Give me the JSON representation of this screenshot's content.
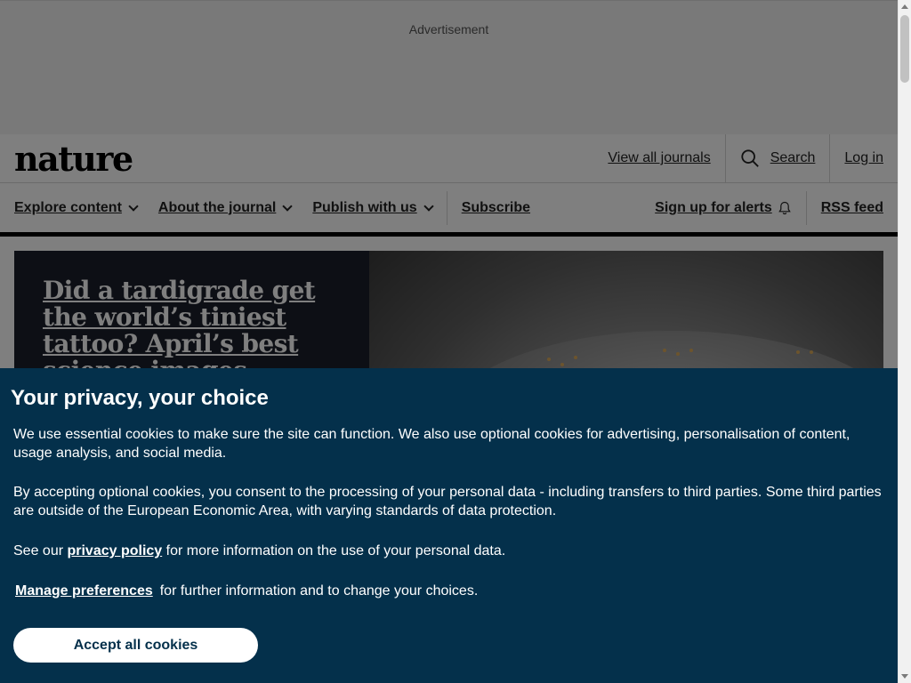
{
  "ad": {
    "label": "Advertisement"
  },
  "masthead": {
    "logo": "nature",
    "view_all_journals": "View all journals",
    "search_label": "Search",
    "login_label": "Log in"
  },
  "nav": {
    "explore": "Explore content",
    "about": "About the journal",
    "publish": "Publish with us",
    "subscribe": "Subscribe",
    "alerts": "Sign up for alerts",
    "rss": "RSS feed"
  },
  "hero": {
    "title_lines": [
      "Did a tardigrade get",
      "the world’s tiniest",
      "tattoo? April’s best",
      "science images"
    ]
  },
  "cookie": {
    "title": "Your privacy, your choice",
    "p1": "We use essential cookies to make sure the site can function. We also use optional cookies for advertising, personalisation of content, usage analysis, and social media.",
    "p2": "By accepting optional cookies, you consent to the processing of your personal data - including transfers to third parties. Some third parties are outside of the European Economic Area, with varying standards of data protection.",
    "p3_before": "See our ",
    "p3_link": "privacy policy",
    "p3_after": " for more information on the use of your personal data.",
    "manage_label": "Manage preferences",
    "manage_after": "for further information and to change your choices.",
    "accept_label": "Accept all cookies"
  },
  "colors": {
    "cookie_bg": "#04304b",
    "hero_bg": "#1b1f2a",
    "accent_black": "#000000"
  }
}
